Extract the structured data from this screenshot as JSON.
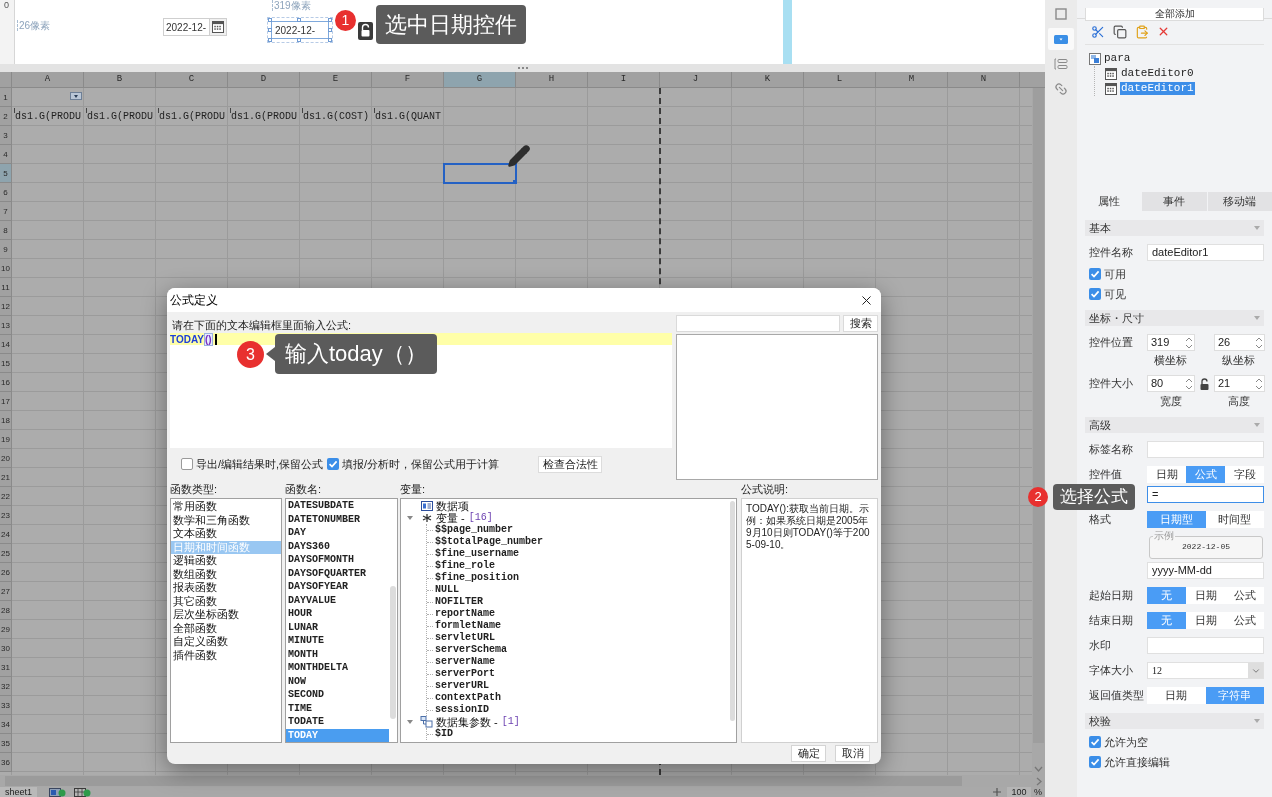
{
  "designer": {
    "ruler_label": "0",
    "guides": [
      {
        "label": "26像素"
      },
      {
        "label": "319像素"
      }
    ],
    "date_editors": [
      {
        "value": "2022-12-",
        "selected": false
      },
      {
        "value": "2022-12-",
        "selected": true
      }
    ],
    "annotation": {
      "number": "1",
      "text": "选中日期控件"
    }
  },
  "sheet": {
    "columns": [
      {
        "label": "A",
        "selected": false
      },
      {
        "label": "B",
        "selected": false
      },
      {
        "label": "C",
        "selected": false
      },
      {
        "label": "D",
        "selected": false
      },
      {
        "label": "E",
        "selected": false
      },
      {
        "label": "F",
        "selected": false
      },
      {
        "label": "G",
        "selected": true
      },
      {
        "label": "H",
        "selected": false
      },
      {
        "label": "I",
        "selected": false
      },
      {
        "label": "J",
        "selected": false
      },
      {
        "label": "K",
        "selected": false
      },
      {
        "label": "L",
        "selected": false
      },
      {
        "label": "M",
        "selected": false
      },
      {
        "label": "N",
        "selected": false
      }
    ],
    "rows": [
      {
        "label": "1",
        "selected": false
      },
      {
        "label": "2",
        "selected": false,
        "cells": [
          "ds1.G(PRODU",
          "ds1.G(PRODU",
          "ds1.G(PRODU",
          "ds1.G(PRODU",
          "ds1.G(COST)",
          "ds1.G(QUANT"
        ]
      },
      {
        "label": "3",
        "selected": false
      },
      {
        "label": "4",
        "selected": false
      },
      {
        "label": "5",
        "selected": true
      },
      {
        "label": "6",
        "selected": false
      },
      {
        "label": "7",
        "selected": false
      },
      {
        "label": "8",
        "selected": false
      },
      {
        "label": "9",
        "selected": false
      },
      {
        "label": "10",
        "selected": false
      },
      {
        "label": "11",
        "selected": false
      },
      {
        "label": "12",
        "selected": false
      },
      {
        "label": "13",
        "selected": false
      },
      {
        "label": "14",
        "selected": false
      },
      {
        "label": "15",
        "selected": false
      },
      {
        "label": "16",
        "selected": false
      },
      {
        "label": "17",
        "selected": false
      },
      {
        "label": "18",
        "selected": false
      },
      {
        "label": "19",
        "selected": false
      },
      {
        "label": "20",
        "selected": false
      },
      {
        "label": "21",
        "selected": false
      },
      {
        "label": "22",
        "selected": false
      },
      {
        "label": "23",
        "selected": false
      },
      {
        "label": "24",
        "selected": false
      },
      {
        "label": "25",
        "selected": false
      },
      {
        "label": "26",
        "selected": false
      },
      {
        "label": "27",
        "selected": false
      },
      {
        "label": "28",
        "selected": false
      },
      {
        "label": "29",
        "selected": false
      },
      {
        "label": "30",
        "selected": false
      },
      {
        "label": "31",
        "selected": false
      },
      {
        "label": "32",
        "selected": false
      },
      {
        "label": "33",
        "selected": false
      },
      {
        "label": "34",
        "selected": false
      },
      {
        "label": "35",
        "selected": false
      },
      {
        "label": "36",
        "selected": false
      }
    ]
  },
  "status_bar": {
    "sheet_tabs": [
      {
        "label": "sheet1",
        "selected": true
      }
    ],
    "zoom": "100",
    "zoom_unit": "%"
  },
  "dialog": {
    "title": "公式定义",
    "prompt": "请在下面的文本编辑框里面输入公式:",
    "formula": [
      {
        "text": "TODAY",
        "kind": "function"
      },
      {
        "text": "()",
        "kind": "bracket"
      }
    ],
    "annotation": {
      "number": "3",
      "text": "输入today（）"
    },
    "search_button": "搜索",
    "options": [
      {
        "label": "导出/编辑结果时,保留公式",
        "checked": false
      },
      {
        "label": "填报/分析时，保留公式用于计算",
        "checked": true
      }
    ],
    "check_button": "检查合法性",
    "function_types": {
      "label": "函数类型:",
      "items": [
        {
          "label": "常用函数",
          "selected": false
        },
        {
          "label": "数学和三角函数",
          "selected": false
        },
        {
          "label": "文本函数",
          "selected": false
        },
        {
          "label": "日期和时间函数",
          "selected": true
        },
        {
          "label": "逻辑函数",
          "selected": false
        },
        {
          "label": "数组函数",
          "selected": false
        },
        {
          "label": "报表函数",
          "selected": false
        },
        {
          "label": "其它函数",
          "selected": false
        },
        {
          "label": "层次坐标函数",
          "selected": false
        },
        {
          "label": "全部函数",
          "selected": false
        },
        {
          "label": "自定义函数",
          "selected": false
        },
        {
          "label": "插件函数",
          "selected": false
        }
      ]
    },
    "function_names": {
      "label": "函数名:",
      "items": [
        {
          "label": "DATESUBDATE",
          "selected": false
        },
        {
          "label": "DATETONUMBER",
          "selected": false
        },
        {
          "label": "DAY",
          "selected": false
        },
        {
          "label": "DAYS360",
          "selected": false
        },
        {
          "label": "DAYSOFMONTH",
          "selected": false
        },
        {
          "label": "DAYSOFQUARTER",
          "selected": false
        },
        {
          "label": "DAYSOFYEAR",
          "selected": false
        },
        {
          "label": "DAYVALUE",
          "selected": false
        },
        {
          "label": "HOUR",
          "selected": false
        },
        {
          "label": "LUNAR",
          "selected": false
        },
        {
          "label": "MINUTE",
          "selected": false
        },
        {
          "label": "MONTH",
          "selected": false
        },
        {
          "label": "MONTHDELTA",
          "selected": false
        },
        {
          "label": "NOW",
          "selected": false
        },
        {
          "label": "SECOND",
          "selected": false
        },
        {
          "label": "TIME",
          "selected": false
        },
        {
          "label": "TODATE",
          "selected": false
        },
        {
          "label": "TODAY",
          "selected": true
        }
      ]
    },
    "variables": {
      "label": "变量:",
      "items": [
        {
          "kind": "data",
          "label": "数据项"
        },
        {
          "kind": "group",
          "label": "变量 -",
          "count": "[16]",
          "expanded": true,
          "children": [
            {
              "label": "$$page_number"
            },
            {
              "label": "$$totalPage_number"
            },
            {
              "label": "$fine_username"
            },
            {
              "label": "$fine_role"
            },
            {
              "label": "$fine_position"
            },
            {
              "label": "NULL"
            },
            {
              "label": "NOFILTER"
            },
            {
              "label": "reportName"
            },
            {
              "label": "formletName"
            },
            {
              "label": "servletURL"
            },
            {
              "label": "serverSchema"
            },
            {
              "label": "serverName"
            },
            {
              "label": "serverPort"
            },
            {
              "label": "serverURL"
            },
            {
              "label": "contextPath"
            },
            {
              "label": "sessionID"
            }
          ]
        },
        {
          "kind": "params",
          "label": "数据集参数 -",
          "count": "[1]",
          "expanded": true,
          "children": [
            {
              "label": "$ID"
            }
          ]
        }
      ]
    },
    "description": {
      "label": "公式说明:",
      "text": "TODAY():获取当前日期。示例：如果系统日期是2005年9月10日则TODAY()等于2005-09-10。"
    },
    "buttons": [
      "确定",
      "取消"
    ]
  },
  "side_strip": {
    "tools": [
      {
        "kind": "frame",
        "selected": false
      },
      {
        "kind": "widget",
        "selected": true
      },
      {
        "kind": "layout",
        "selected": false
      },
      {
        "kind": "link",
        "selected": false
      }
    ]
  },
  "panel": {
    "add_all_button": "全部添加",
    "toolbar": [
      {
        "kind": "cut"
      },
      {
        "kind": "copy"
      },
      {
        "kind": "paste"
      },
      {
        "kind": "delete"
      }
    ],
    "tree": {
      "label": "para",
      "children": [
        {
          "label": "dateEditor0",
          "selected": false
        },
        {
          "label": "dateEditor1",
          "selected": true
        }
      ]
    },
    "tabs": [
      {
        "label": "属性",
        "selected": true
      },
      {
        "label": "事件",
        "selected": false
      },
      {
        "label": "移动端",
        "selected": false
      }
    ],
    "sections": [
      {
        "title": "基本",
        "fields": [
          {
            "kind": "text",
            "label": "控件名称",
            "value": "dateEditor1"
          },
          {
            "kind": "checkbox",
            "label": "可用",
            "checked": true
          },
          {
            "kind": "checkbox",
            "label": "可见",
            "checked": true
          }
        ]
      },
      {
        "title": "坐标・尺寸",
        "fields": [
          {
            "kind": "pair",
            "label": "控件位置",
            "items": [
              {
                "value": "319",
                "caption": "横坐标"
              },
              {
                "value": "26",
                "caption": "纵坐标"
              }
            ]
          },
          {
            "kind": "pair",
            "label": "控件大小",
            "locked": false,
            "items": [
              {
                "value": "80",
                "caption": "宽度"
              },
              {
                "value": "21",
                "caption": "高度"
              }
            ]
          }
        ]
      },
      {
        "title": "高级",
        "fields": [
          {
            "kind": "text",
            "label": "标签名称"
          },
          {
            "kind": "segmented",
            "label": "控件值",
            "options": [
              {
                "label": "日期",
                "selected": false
              },
              {
                "label": "公式",
                "selected": true
              },
              {
                "label": "字段",
                "selected": false
              }
            ]
          },
          {
            "kind": "text",
            "value": "=",
            "focused": true
          },
          {
            "kind": "segmented",
            "label": "格式",
            "options": [
              {
                "label": "日期型",
                "selected": true
              },
              {
                "label": "时间型",
                "selected": false
              }
            ]
          },
          {
            "kind": "example",
            "legend": "示例",
            "value": "2022-12-05"
          },
          {
            "kind": "text",
            "value": "yyyy-MM-dd"
          },
          {
            "kind": "segmented",
            "label": "起始日期",
            "options": [
              {
                "label": "无",
                "selected": true
              },
              {
                "label": "日期",
                "selected": false
              },
              {
                "label": "公式",
                "selected": false
              }
            ]
          },
          {
            "kind": "segmented",
            "label": "结束日期",
            "options": [
              {
                "label": "无",
                "selected": true
              },
              {
                "label": "日期",
                "selected": false
              },
              {
                "label": "公式",
                "selected": false
              }
            ]
          },
          {
            "kind": "text",
            "label": "水印"
          },
          {
            "kind": "select",
            "label": "字体大小",
            "value": "12"
          },
          {
            "kind": "segmented",
            "label": "返回值类型",
            "options": [
              {
                "label": "日期",
                "selected": false
              },
              {
                "label": "字符串",
                "selected": true
              }
            ]
          }
        ]
      },
      {
        "title": "校验",
        "fields": [
          {
            "kind": "checkbox",
            "label": "允许为空",
            "checked": true
          },
          {
            "kind": "checkbox",
            "label": "允许直接编辑",
            "checked": true
          }
        ]
      }
    ],
    "annotation": {
      "number": "2",
      "text": "选择公式"
    }
  }
}
